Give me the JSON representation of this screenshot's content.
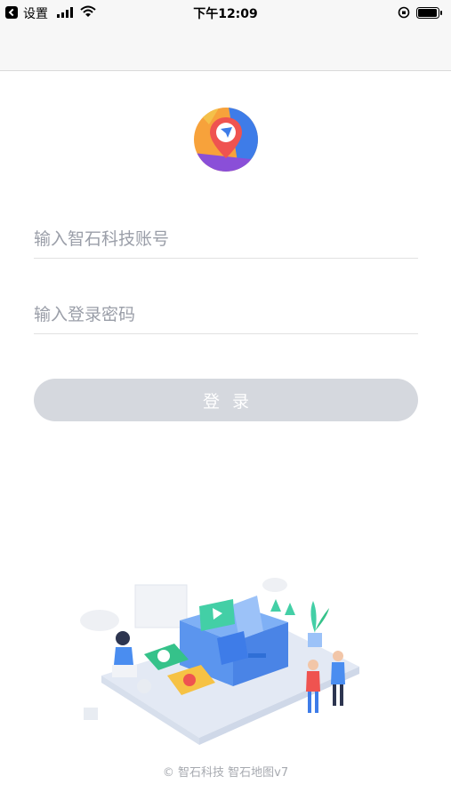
{
  "status_bar": {
    "carrier": "设置",
    "time": "下午12:09"
  },
  "login": {
    "account_placeholder": "输入智石科技账号",
    "password_placeholder": "输入登录密码",
    "submit_label": "登录"
  },
  "footer": {
    "copyright": "© 智石科技 智石地图v7"
  },
  "colors": {
    "button_disabled": "#d5d8de",
    "placeholder": "#9a9ea8",
    "logo_orange": "#f7a23b",
    "logo_blue": "#3e7ce8",
    "logo_purple": "#8a4fd8",
    "logo_red": "#ef5350"
  }
}
